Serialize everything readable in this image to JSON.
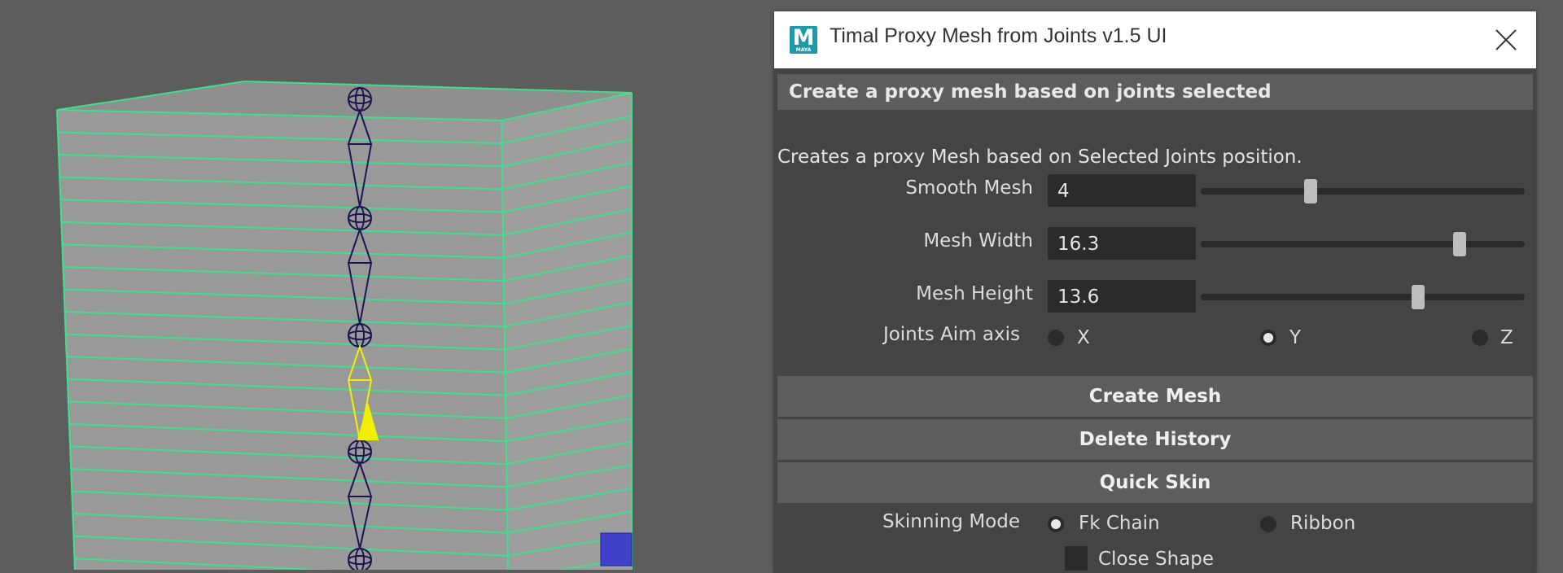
{
  "window": {
    "title": "Timal Proxy Mesh from Joints v1.5 UI",
    "logo_letter": "M",
    "logo_caption": "MAYA"
  },
  "section": {
    "header": "Create a proxy mesh based on joints selected"
  },
  "description": "Creates a proxy Mesh based on Selected Joints position.",
  "fields": {
    "smooth_mesh": {
      "label": "Smooth Mesh",
      "value": "4",
      "slider_fraction": 0.34
    },
    "mesh_width": {
      "label": "Mesh Width",
      "value": "16.3",
      "slider_fraction": 0.8
    },
    "mesh_height": {
      "label": "Mesh Height",
      "value": "13.6",
      "slider_fraction": 0.67
    }
  },
  "aim_axis": {
    "label": "Joints Aim axis",
    "options": [
      "X",
      "Y",
      "Z"
    ],
    "selected": "Y"
  },
  "buttons": {
    "create_mesh": "Create Mesh",
    "delete_history": "Delete History",
    "quick_skin": "Quick Skin"
  },
  "skinning": {
    "label": "Skinning Mode",
    "options": [
      "Fk Chain",
      "Ribbon"
    ],
    "selected": "Fk Chain"
  },
  "close_shape": {
    "label": "Close Shape",
    "checked": false
  },
  "colors": {
    "viewport_bg": "#5d5d5d",
    "mesh_face": "#9a9a9a",
    "wireframe": "#3de08e",
    "joint": "#1e1450",
    "selected_joint": "#f0f000",
    "panel_bg": "#444444"
  }
}
